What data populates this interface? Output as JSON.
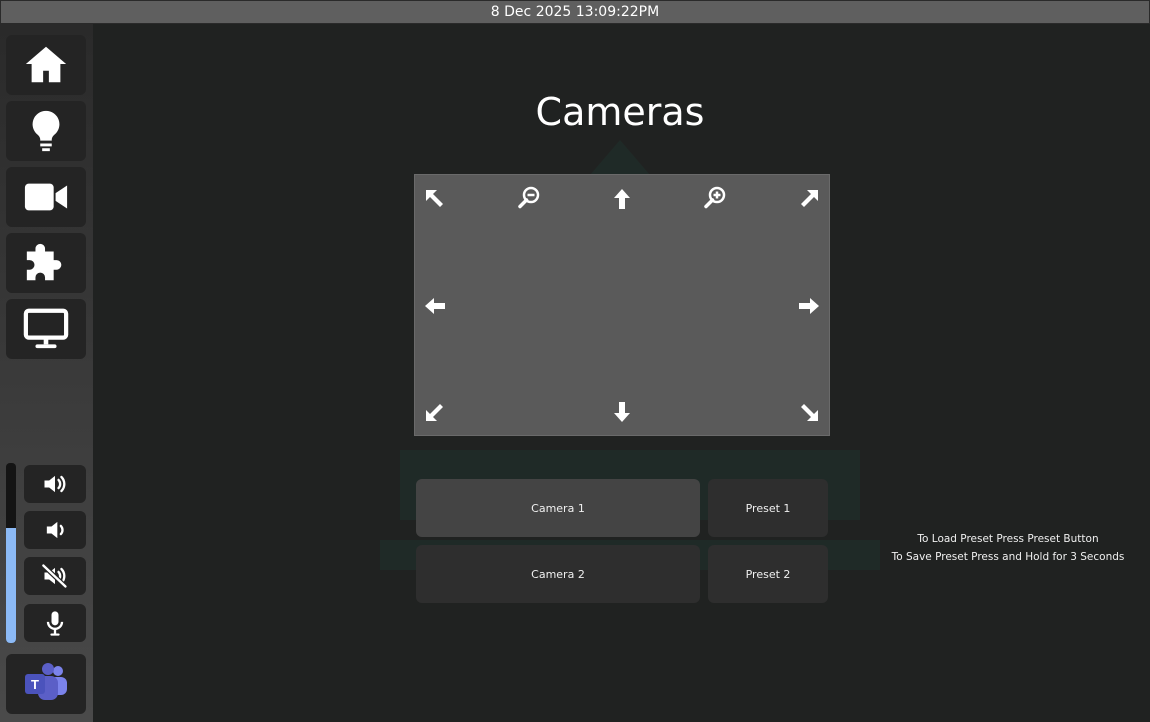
{
  "topbar": {
    "datetime": "8 Dec 2025 13:09:22PM"
  },
  "sidebar": {
    "nav": [
      {
        "icon": "home-icon"
      },
      {
        "icon": "lightbulb-icon"
      },
      {
        "icon": "video-camera-icon"
      },
      {
        "icon": "puzzle-icon"
      },
      {
        "icon": "monitor-icon"
      }
    ],
    "volume": {
      "level_percent": 64,
      "fill_color": "#8cbaf6"
    },
    "audio_buttons": [
      {
        "icon": "volume-up-icon"
      },
      {
        "icon": "volume-down-icon"
      },
      {
        "icon": "mute-icon"
      },
      {
        "icon": "microphone-icon"
      }
    ],
    "teams": {
      "icon": "microsoft-teams-icon",
      "letter": "T",
      "color": "#5b5fc7"
    }
  },
  "page": {
    "title": "Cameras"
  },
  "ptz": {
    "buttons": [
      "pan-up-left",
      "zoom-out",
      "tilt-up",
      "zoom-in",
      "pan-up-right",
      "pan-left",
      "pan-right",
      "pan-down-left",
      "tilt-down",
      "pan-down-right"
    ]
  },
  "cameras": [
    {
      "label": "Camera 1",
      "selected": true
    },
    {
      "label": "Camera 2",
      "selected": false
    }
  ],
  "presets": [
    {
      "label": "Preset 1"
    },
    {
      "label": "Preset 2"
    }
  ],
  "hints": {
    "load": "To Load Preset Press Preset Button",
    "save": "To Save Preset Press and Hold for 3 Seconds"
  }
}
